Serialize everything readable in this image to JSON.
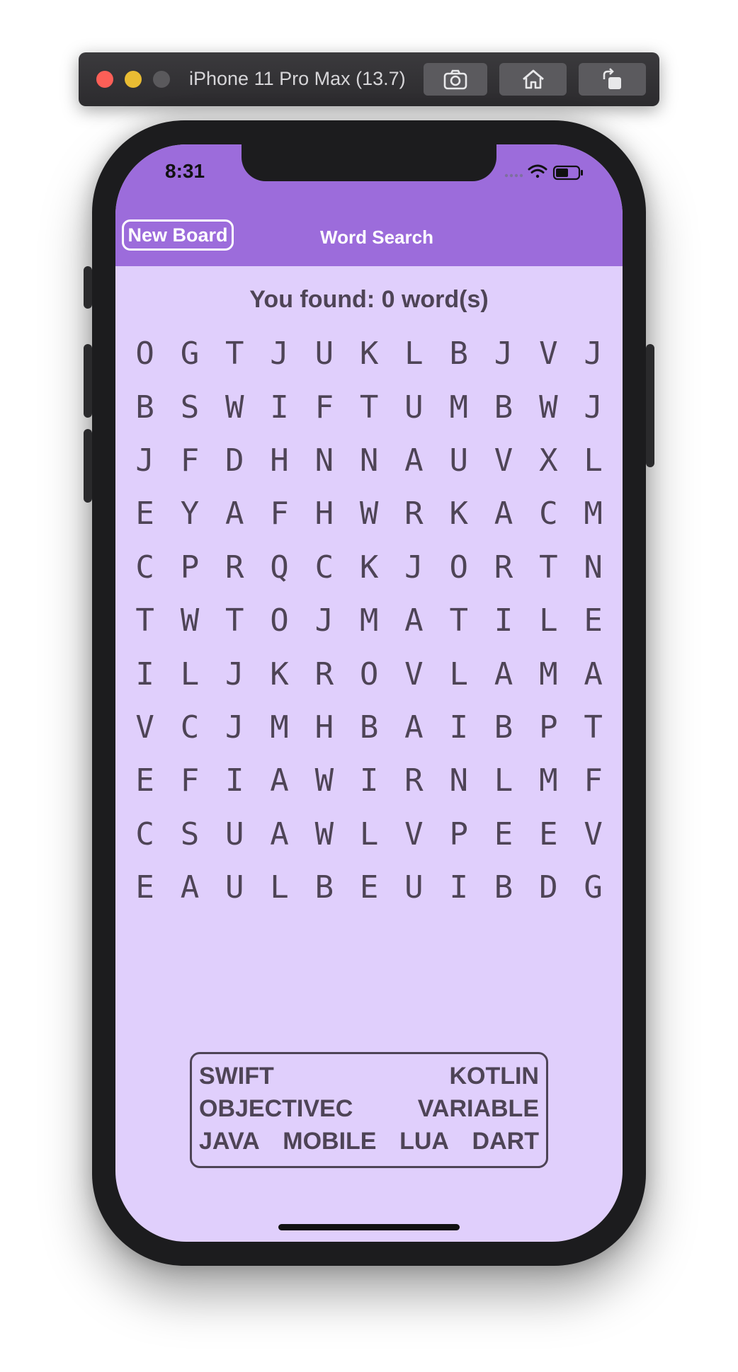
{
  "simulator": {
    "title": "iPhone 11 Pro Max (13.7)"
  },
  "status_bar": {
    "time": "8:31"
  },
  "nav": {
    "new_board_label": "New Board",
    "title": "Word Search"
  },
  "score": {
    "found_text": "You found: 0 word(s)"
  },
  "grid": {
    "rows": [
      [
        "O",
        "G",
        "T",
        "J",
        "U",
        "K",
        "L",
        "B",
        "J",
        "V",
        "J"
      ],
      [
        "B",
        "S",
        "W",
        "I",
        "F",
        "T",
        "U",
        "M",
        "B",
        "W",
        "J"
      ],
      [
        "J",
        "F",
        "D",
        "H",
        "N",
        "N",
        "A",
        "U",
        "V",
        "X",
        "L"
      ],
      [
        "E",
        "Y",
        "A",
        "F",
        "H",
        "W",
        "R",
        "K",
        "A",
        "C",
        "M"
      ],
      [
        "C",
        "P",
        "R",
        "Q",
        "C",
        "K",
        "J",
        "O",
        "R",
        "T",
        "N"
      ],
      [
        "T",
        "W",
        "T",
        "O",
        "J",
        "M",
        "A",
        "T",
        "I",
        "L",
        "E"
      ],
      [
        "I",
        "L",
        "J",
        "K",
        "R",
        "O",
        "V",
        "L",
        "A",
        "M",
        "A"
      ],
      [
        "V",
        "C",
        "J",
        "M",
        "H",
        "B",
        "A",
        "I",
        "B",
        "P",
        "T"
      ],
      [
        "E",
        "F",
        "I",
        "A",
        "W",
        "I",
        "R",
        "N",
        "L",
        "M",
        "F"
      ],
      [
        "C",
        "S",
        "U",
        "A",
        "W",
        "L",
        "V",
        "P",
        "E",
        "E",
        "V"
      ],
      [
        "E",
        "A",
        "U",
        "L",
        "B",
        "E",
        "U",
        "I",
        "B",
        "D",
        "G"
      ]
    ]
  },
  "word_list": {
    "lines": [
      [
        "SWIFT",
        "KOTLIN"
      ],
      [
        "OBJECTIVEC",
        "VARIABLE"
      ],
      [
        "JAVA",
        "MOBILE",
        "LUA",
        "DART"
      ]
    ]
  },
  "colors": {
    "header": "#9c6cdb",
    "background": "#e0cffc",
    "text": "#4e4456"
  }
}
